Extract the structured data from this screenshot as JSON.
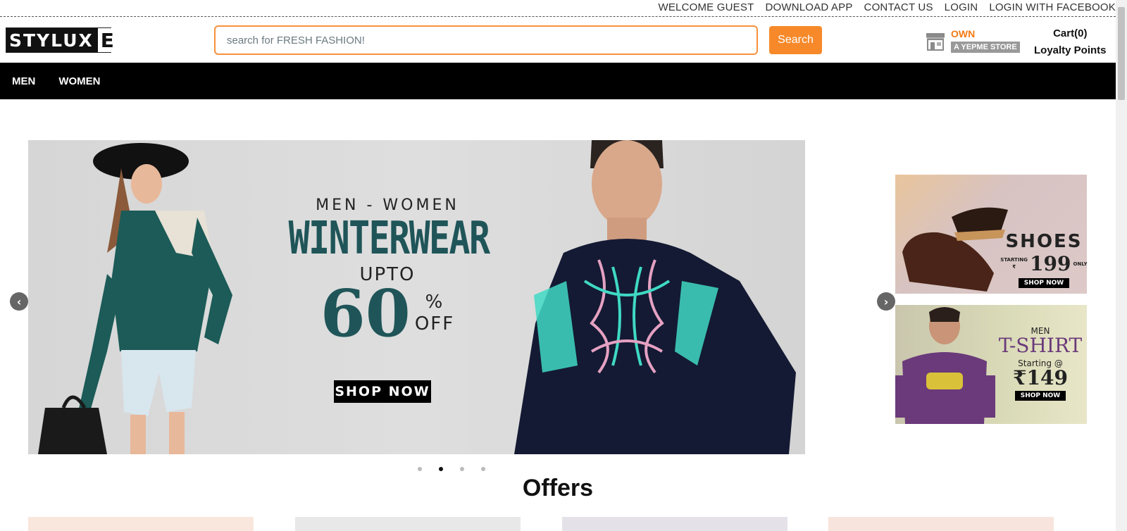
{
  "topbar": {
    "links": [
      "WELCOME GUEST",
      "DOWNLOAD APP",
      "CONTACT US",
      "LOGIN",
      "LOGIN WITH FACEBOOK"
    ]
  },
  "header": {
    "logo_left": "STYLUX",
    "logo_right": "E",
    "search_placeholder": "search for FRESH FASHION!",
    "search_button": "Search",
    "own_label": "OWN",
    "store_label": "A YEPME STORE",
    "cart_label": "Cart(0)",
    "loyalty_label": "Loyalty Points"
  },
  "nav": {
    "items": [
      "MEN",
      "WOMEN"
    ]
  },
  "slider": {
    "subtitle": "MEN - WOMEN",
    "title": "WINTERWEAR",
    "upto": "UPTO",
    "discount": "60",
    "percent": "%",
    "off": "OFF",
    "cta": "SHOP NOW",
    "prev_icon": "‹",
    "next_icon": "›",
    "active_dot": 1,
    "dot_count": 4
  },
  "promos": {
    "shoes": {
      "title": "SHOES",
      "starting": "STARTING",
      "currency": "₹",
      "price": "199",
      "suffix": "ONLY",
      "cta": "SHOP NOW"
    },
    "tshirt": {
      "category": "MEN",
      "title": "T-SHIRT",
      "starting": "Starting @",
      "price": "₹149",
      "cta": "SHOP NOW"
    }
  },
  "offers": {
    "title": "Offers"
  },
  "colors": {
    "accent": "#f7892a",
    "teal": "#1f5559"
  }
}
